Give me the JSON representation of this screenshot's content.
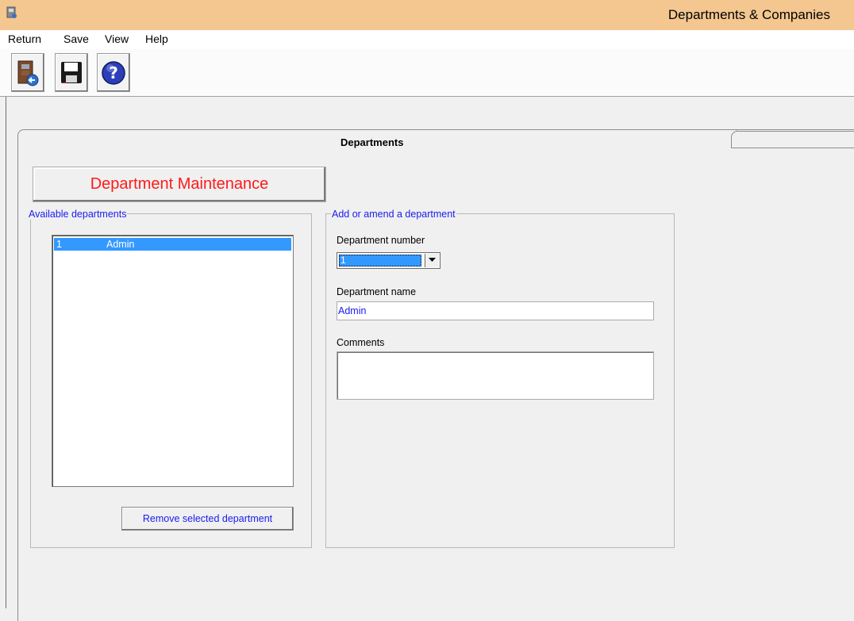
{
  "window": {
    "title": "Departments & Companies"
  },
  "menu": [
    "Return",
    "Save",
    "View",
    "Help"
  ],
  "toolbar": {
    "buttons": [
      {
        "icon": "return-door-icon"
      },
      {
        "icon": "save-disk-icon"
      },
      {
        "icon": "help-question-icon"
      }
    ]
  },
  "tabs": {
    "active": "Departments",
    "inactive": ""
  },
  "maintenance_button": "Department Maintenance",
  "available": {
    "legend": "Available departments",
    "items": [
      {
        "number": "1",
        "name": "Admin",
        "selected": true
      }
    ],
    "remove_button": "Remove selected department"
  },
  "amend": {
    "legend": "Add or amend a department",
    "number_label": "Department number",
    "number_value": "1",
    "name_label": "Department name",
    "name_value": "Admin",
    "comments_label": "Comments",
    "comments_value": ""
  },
  "colors": {
    "title_bar": "#f4c690",
    "legend_text": "#1a1af0",
    "maintenance_text": "#ff1a1a",
    "selection": "#3399ff"
  }
}
